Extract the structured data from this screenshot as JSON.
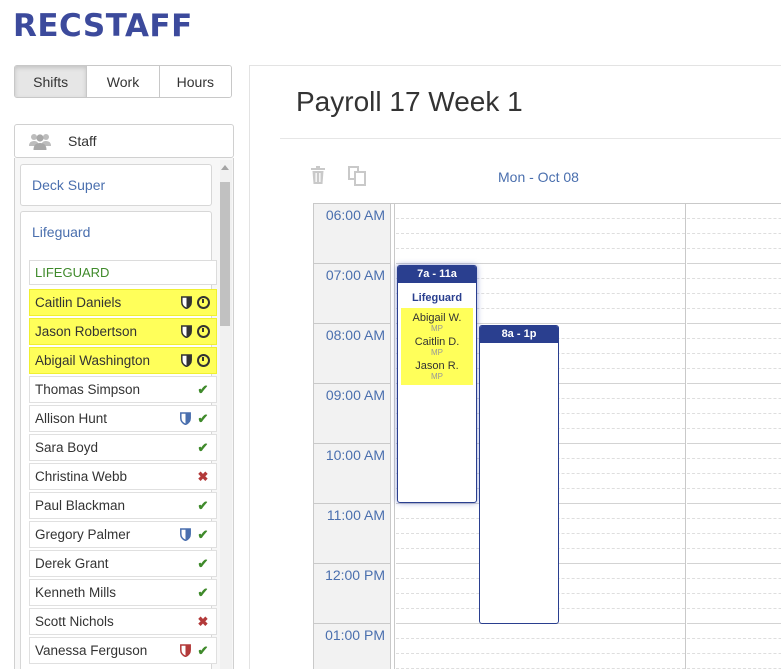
{
  "app": {
    "logo": "RECSTAFF"
  },
  "tabs": [
    {
      "label": "Shifts",
      "active": true
    },
    {
      "label": "Work",
      "active": false
    },
    {
      "label": "Hours",
      "active": false
    }
  ],
  "staff_header": {
    "label": "Staff",
    "icon": "users-icon"
  },
  "groups": {
    "deck_super": {
      "title": "Deck Super"
    },
    "lifeguard": {
      "title": "Lifeguard",
      "subheader": "LIFEGUARD"
    }
  },
  "staff": [
    {
      "name": "Caitlin Daniels",
      "highlight": true,
      "icons": [
        "shield-dark",
        "clock"
      ]
    },
    {
      "name": "Jason Robertson",
      "highlight": true,
      "icons": [
        "shield-dark",
        "clock"
      ]
    },
    {
      "name": "Abigail Washington",
      "highlight": true,
      "icons": [
        "shield-dark",
        "clock"
      ]
    },
    {
      "name": "Thomas Simpson",
      "highlight": false,
      "icons": [
        "check"
      ]
    },
    {
      "name": "Allison Hunt",
      "highlight": false,
      "icons": [
        "shield-blue",
        "check"
      ]
    },
    {
      "name": "Sara Boyd",
      "highlight": false,
      "icons": [
        "check"
      ]
    },
    {
      "name": "Christina Webb",
      "highlight": false,
      "icons": [
        "x"
      ]
    },
    {
      "name": "Paul Blackman",
      "highlight": false,
      "icons": [
        "check"
      ]
    },
    {
      "name": "Gregory Palmer",
      "highlight": false,
      "icons": [
        "shield-blue",
        "check"
      ]
    },
    {
      "name": "Derek Grant",
      "highlight": false,
      "icons": [
        "check"
      ]
    },
    {
      "name": "Kenneth Mills",
      "highlight": false,
      "icons": [
        "check"
      ]
    },
    {
      "name": "Scott Nichols",
      "highlight": false,
      "icons": [
        "x"
      ]
    },
    {
      "name": "Vanessa Ferguson",
      "highlight": false,
      "icons": [
        "shield-red",
        "check"
      ]
    }
  ],
  "main": {
    "title": "Payroll 17 Week 1",
    "day_header": "Mon - Oct 08",
    "times": [
      "06:00 AM",
      "07:00 AM",
      "08:00 AM",
      "09:00 AM",
      "10:00 AM",
      "11:00 AM",
      "12:00 PM",
      "01:00 PM"
    ],
    "shifts": [
      {
        "time": "7a - 11a",
        "position": "Lifeguard",
        "assigned": [
          {
            "name": "Abigail W.",
            "tag": "MP"
          },
          {
            "name": "Caitlin D.",
            "tag": "MP"
          },
          {
            "name": "Jason R.",
            "tag": "MP"
          }
        ]
      },
      {
        "time": "8a - 1p",
        "position": "",
        "assigned": []
      }
    ]
  },
  "colors": {
    "brand": "#3c4a9c",
    "link": "#4a6fae",
    "shift": "#2a3f8f",
    "highlight": "#ffff5a",
    "ok": "#3f8a2b",
    "error": "#b33a3a"
  }
}
